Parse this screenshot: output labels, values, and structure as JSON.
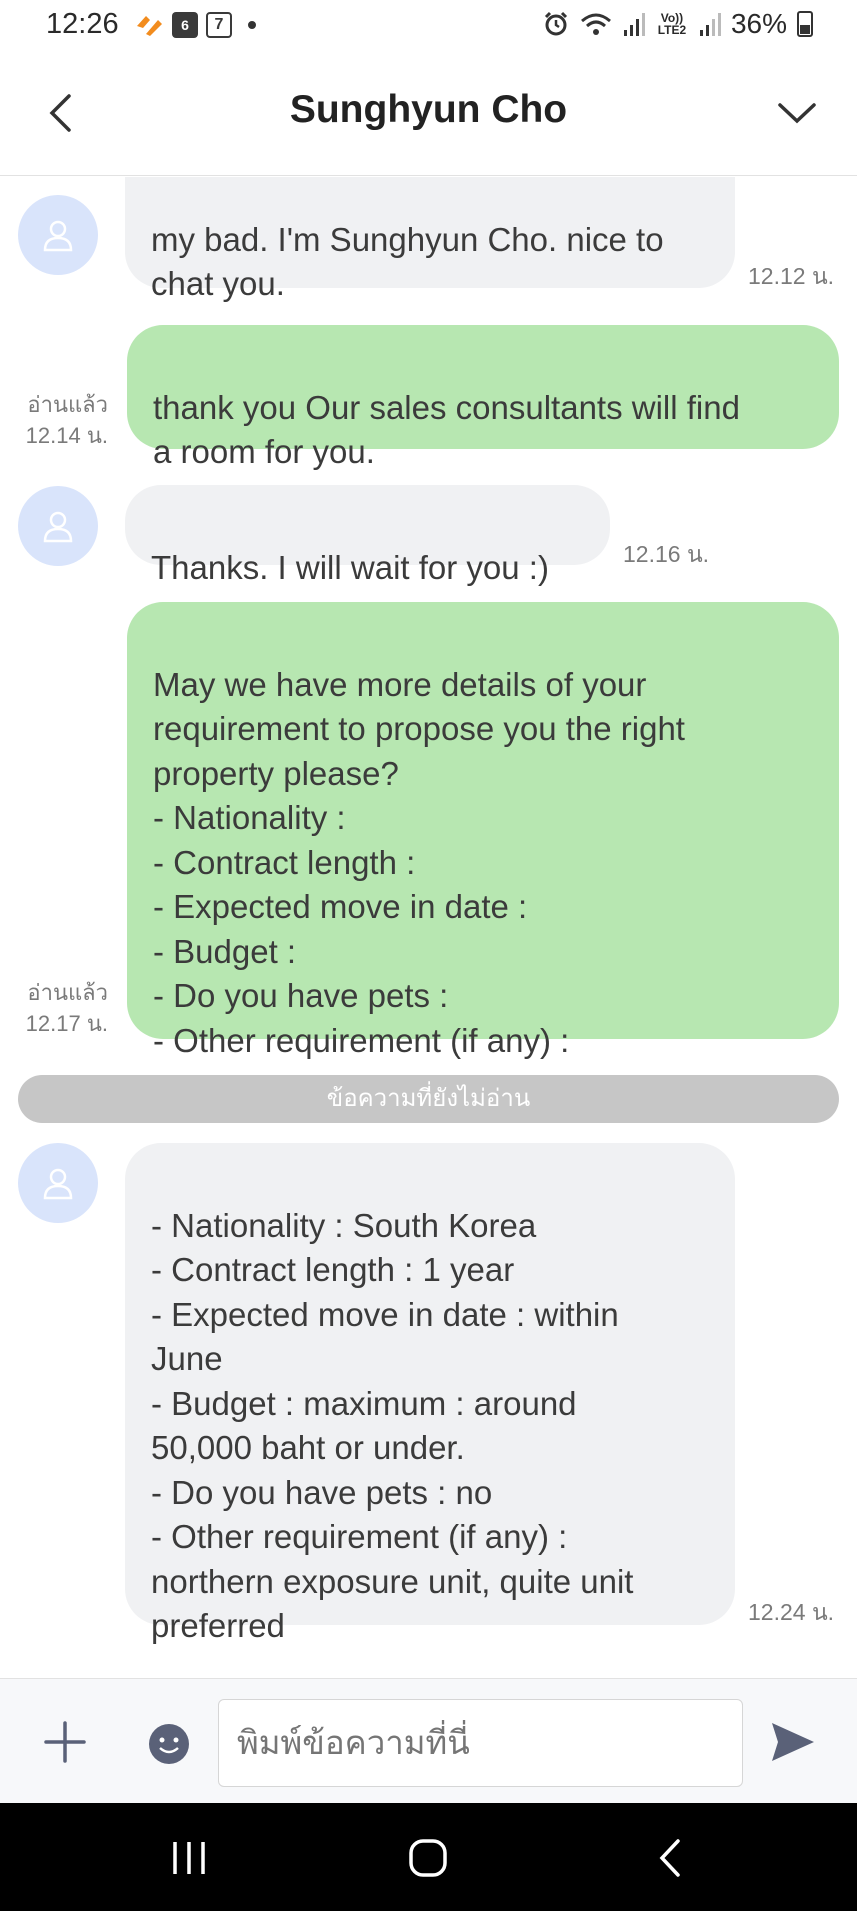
{
  "status_bar": {
    "time": "12:26",
    "notif_icons": [
      "7-eleven-icon",
      "calendar-icon",
      "shop-icon"
    ],
    "calendar_day": "6",
    "battery": "36%",
    "volte": "Vo)) LTE2"
  },
  "header": {
    "title": "Sunghyun Cho"
  },
  "messages": [
    {
      "direction": "in",
      "text": "my bad. I'm Sunghyun Cho. nice to\nchat you.",
      "time": "12.12 น."
    },
    {
      "direction": "out",
      "text": "thank you Our sales consultants will find\na room for you.",
      "read": "อ่านแล้ว",
      "time": "12.14 น."
    },
    {
      "direction": "in",
      "text": "Thanks. I will wait for you :)",
      "time": "12.16 น."
    },
    {
      "direction": "out",
      "text": "May we have more details of your\nrequirement to propose you the right\nproperty please?\n- Nationality :\n- Contract length :\n- Expected move in date :\n- Budget :\n- Do you have pets :\n- Other requirement (if any) :",
      "read": "อ่านแล้ว",
      "time": "12.17 น."
    },
    {
      "direction": "in",
      "text": "- Nationality : South Korea\n- Contract length : 1 year\n- Expected move in date : within\nJune\n- Budget : maximum : around\n50,000 baht or under.\n- Do you have pets : no\n- Other requirement (if any) :\nnorthern exposure unit, quite unit\npreferred",
      "time": "12.24 น."
    }
  ],
  "unread_divider": "ข้อความที่ยังไม่อ่าน",
  "composer": {
    "placeholder": "พิมพ์ข้อความที่นี่"
  },
  "colors": {
    "outgoing_bubble": "#b7e7b1",
    "incoming_bubble": "#f0f1f3",
    "avatar_bg": "#d9e4fb",
    "divider": "#c6c6c6"
  }
}
